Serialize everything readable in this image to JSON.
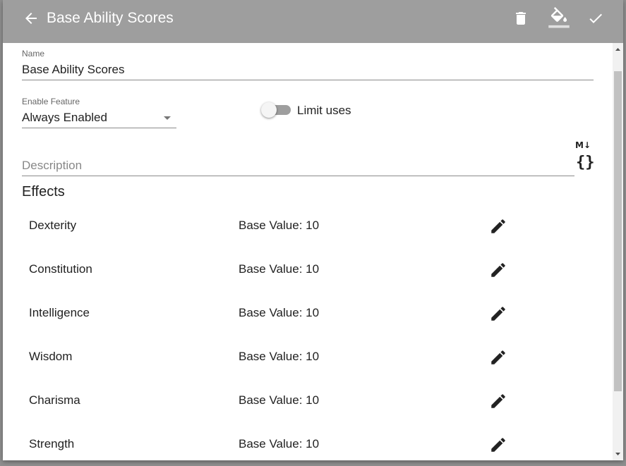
{
  "toolbar": {
    "title": "Base Ability Scores",
    "back_icon": "arrow-left-icon",
    "delete_icon": "delete-icon",
    "color_icon": "format-color-fill-icon",
    "confirm_icon": "check-icon",
    "background_color": "#9e9e9e"
  },
  "form": {
    "name_label": "Name",
    "name_value": "Base Ability Scores",
    "enable_label": "Enable Feature",
    "enable_value": "Always Enabled",
    "limit_uses_label": "Limit uses",
    "limit_uses_enabled": false,
    "description_placeholder": "Description",
    "markdown_badge": "M↓",
    "braces_icon": "{}"
  },
  "effects": {
    "title": "Effects",
    "items": [
      {
        "name": "Dexterity",
        "value": "Base Value: 10"
      },
      {
        "name": "Constitution",
        "value": "Base Value: 10"
      },
      {
        "name": "Intelligence",
        "value": "Base Value: 10"
      },
      {
        "name": "Wisdom",
        "value": "Base Value: 10"
      },
      {
        "name": "Charisma",
        "value": "Base Value: 10"
      },
      {
        "name": "Strength",
        "value": "Base Value: 10"
      }
    ]
  }
}
